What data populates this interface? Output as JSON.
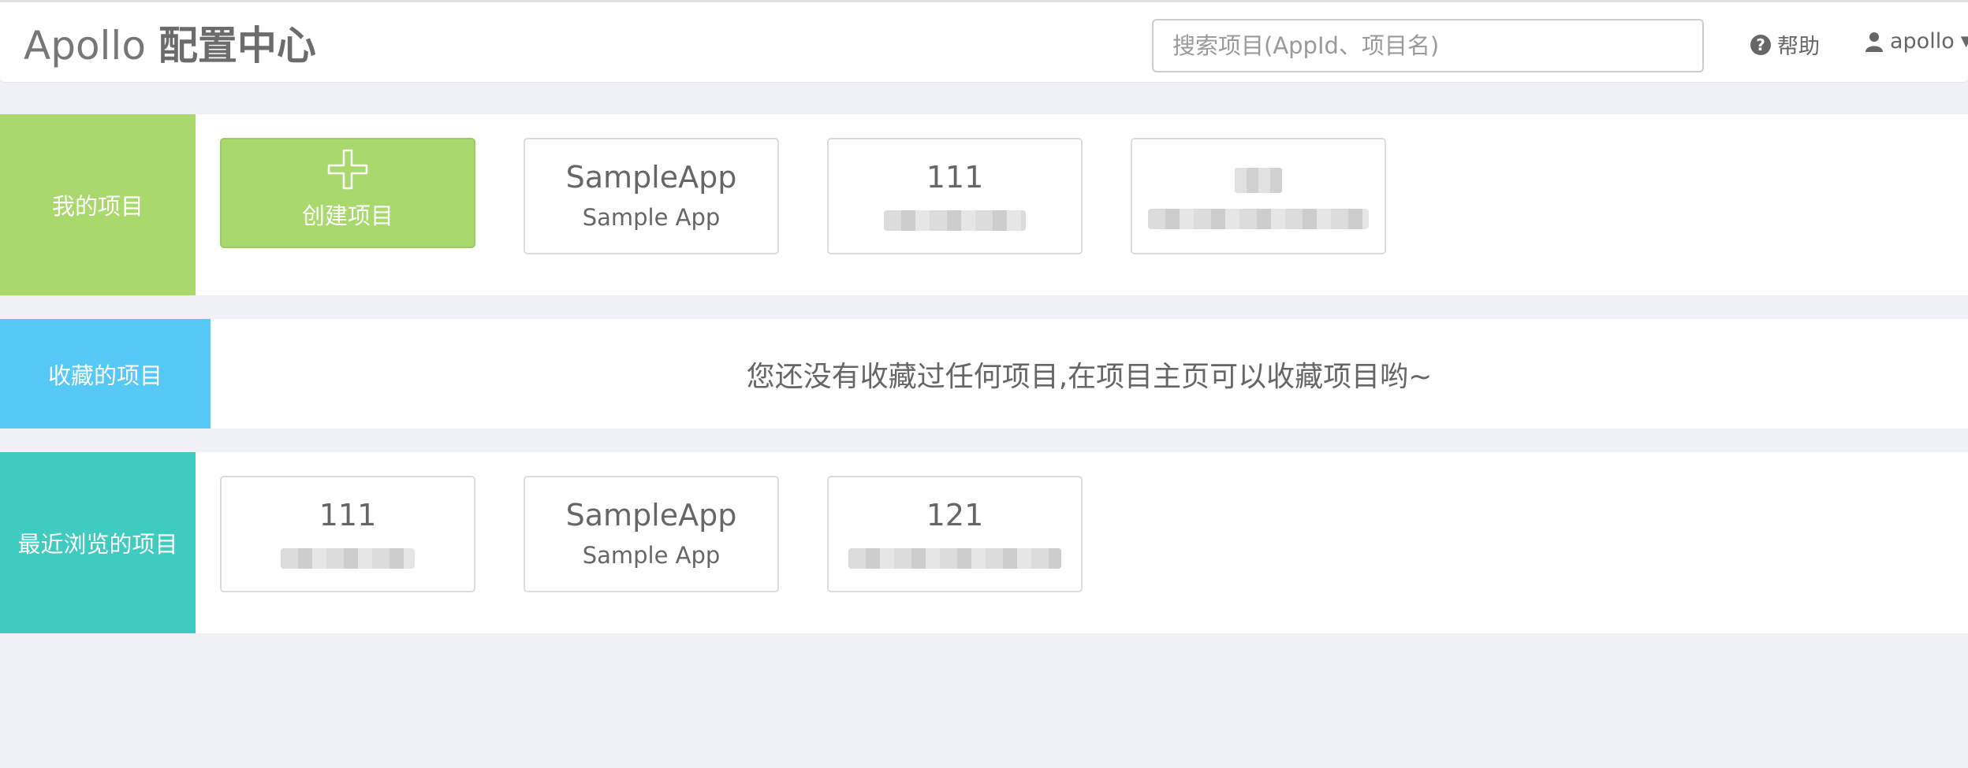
{
  "navbar": {
    "brand_en": "Apollo",
    "brand_cn": "配置中心",
    "search_placeholder": "搜索项目(AppId、项目名)",
    "help_label": "帮助",
    "user_label": "apollo"
  },
  "sections": {
    "mine": {
      "label": "我的项目",
      "create_label": "创建项目",
      "cards": [
        {
          "appid": "SampleApp",
          "name": "Sample App"
        },
        {
          "appid": "111",
          "name": ""
        },
        {
          "appid": "",
          "name": ""
        }
      ]
    },
    "favorites": {
      "label": "收藏的项目",
      "empty_text": "您还没有收藏过任何项目,在项目主页可以收藏项目哟~"
    },
    "recent": {
      "label": "最近浏览的项目",
      "cards": [
        {
          "appid": "111",
          "name": ""
        },
        {
          "appid": "SampleApp",
          "name": "Sample App"
        },
        {
          "appid": "121",
          "name": ""
        }
      ]
    }
  },
  "colors": {
    "mine": "#a9d96c",
    "favorites": "#55c8f5",
    "recent": "#3fcbbf",
    "background": "#f0f1f6"
  }
}
